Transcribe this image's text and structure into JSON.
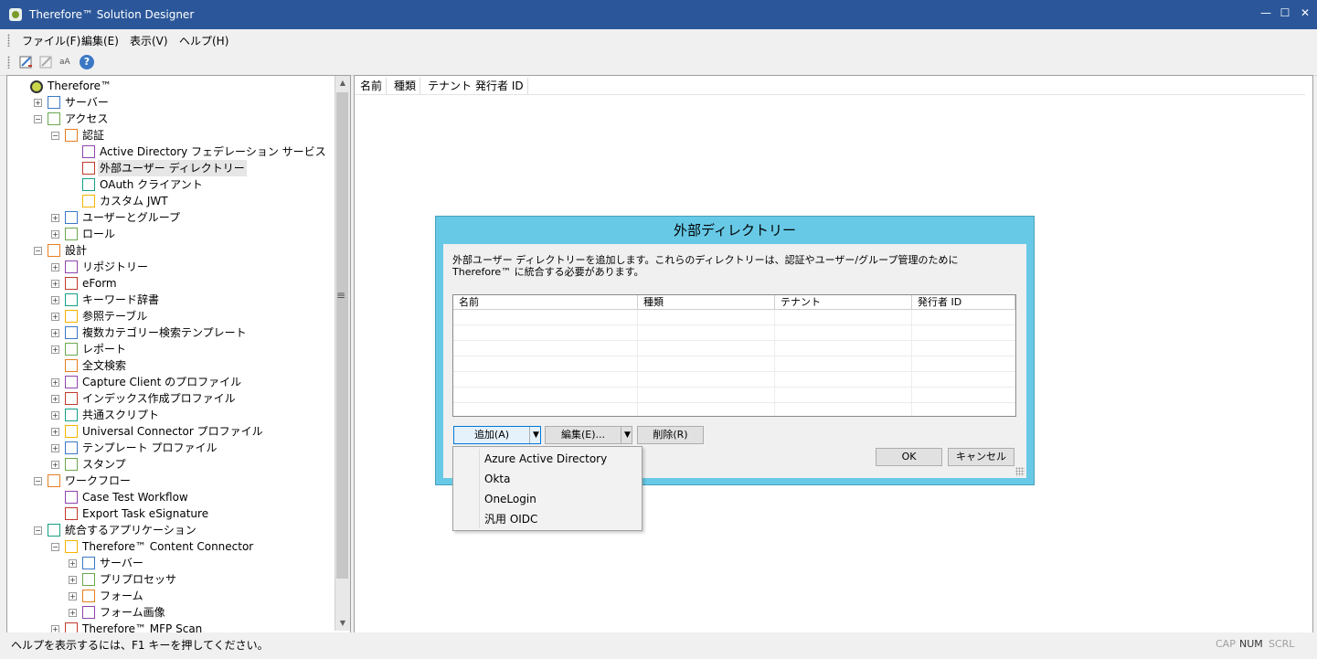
{
  "window": {
    "title": "Therefore™ Solution Designer",
    "controls": {
      "minimize": "—",
      "maximize": "☐",
      "close": "✕"
    }
  },
  "menu": {
    "items": [
      {
        "label": "ファイル(F)"
      },
      {
        "label": "編集(E)"
      },
      {
        "label": "表示(V)"
      },
      {
        "label": "ヘルプ(H)"
      }
    ]
  },
  "toolbar": {
    "icons": [
      "wizard-icon",
      "wizard-disabled-icon",
      "rename-icon",
      "help-icon"
    ],
    "help_glyph": "?",
    "rename_glyph": "aA"
  },
  "tree": {
    "items": [
      {
        "label": "Therefore™",
        "icon": "root-circle-icon"
      },
      {
        "label": "サーバー",
        "icon": "server-icon"
      },
      {
        "label": "アクセス",
        "icon": "access-icon"
      },
      {
        "label": "認証",
        "icon": "folder-card-icon"
      },
      {
        "label": "Active Directory フェデレーション サービス",
        "icon": "id-card-icon"
      },
      {
        "label": "外部ユーザー ディレクトリー",
        "icon": "id-card-icon"
      },
      {
        "label": "OAuth クライアント",
        "icon": "id-card-icon"
      },
      {
        "label": "カスタム JWT",
        "icon": "id-card-icon"
      },
      {
        "label": "ユーザーとグループ",
        "icon": "users-icon"
      },
      {
        "label": "ロール",
        "icon": "role-icon"
      },
      {
        "label": "設計",
        "icon": "design-icon"
      },
      {
        "label": "リポジトリー",
        "icon": "repository-icon"
      },
      {
        "label": "eForm",
        "icon": "eform-icon"
      },
      {
        "label": "キーワード辞書",
        "icon": "dictionary-icon"
      },
      {
        "label": "参照テーブル",
        "icon": "table-icon"
      },
      {
        "label": "複数カテゴリー検索テンプレート",
        "icon": "search-template-icon"
      },
      {
        "label": "レポート",
        "icon": "report-icon"
      },
      {
        "label": "全文検索",
        "icon": "fulltext-icon"
      },
      {
        "label": "Capture Client のプロファイル",
        "icon": "capture-icon"
      },
      {
        "label": "インデックス作成プロファイル",
        "icon": "indexing-icon"
      },
      {
        "label": "共通スクリプト",
        "icon": "script-icon"
      },
      {
        "label": "Universal Connector プロファイル",
        "icon": "connector-icon"
      },
      {
        "label": "テンプレート プロファイル",
        "icon": "template-icon"
      },
      {
        "label": "スタンプ",
        "icon": "stamp-icon"
      },
      {
        "label": "ワークフロー",
        "icon": "workflow-icon"
      },
      {
        "label": "Case Test Workflow",
        "icon": "workflow-icon"
      },
      {
        "label": "Export Task eSignature",
        "icon": "workflow-icon"
      },
      {
        "label": "統合するアプリケーション",
        "icon": "integration-icon"
      },
      {
        "label": "Therefore™ Content Connector",
        "icon": "content-connector-icon"
      },
      {
        "label": "サーバー",
        "icon": "server-icon"
      },
      {
        "label": "プリプロセッサ",
        "icon": "preprocessor-icon"
      },
      {
        "label": "フォーム",
        "icon": "form-icon"
      },
      {
        "label": "フォーム画像",
        "icon": "form-image-icon"
      },
      {
        "label": "Therefore™ MFP Scan",
        "icon": "mfp-icon"
      }
    ]
  },
  "splitter": {
    "grip": "≡"
  },
  "main": {
    "columns": [
      "名前",
      "種類",
      "テナント",
      "発行者 ID"
    ]
  },
  "dialog": {
    "title": "外部ディレクトリー",
    "description": "外部ユーザー ディレクトリーを追加します。これらのディレクトリーは、認証やユーザー/グループ管理のために Therefore™ に統合する必要があります。",
    "columns": [
      "名前",
      "種類",
      "テナント",
      "発行者 ID"
    ],
    "add_label": "追加(A)",
    "edit_label": "編集(E)...",
    "delete_label": "削除(R)",
    "ok_label": "OK",
    "cancel_label": "キャンセル",
    "dropdown_arrow": "▼"
  },
  "add_menu": {
    "items": [
      "Azure Active Directory",
      "Okta",
      "OneLogin",
      "汎用 OIDC"
    ]
  },
  "status": {
    "text": "ヘルプを表示するには、F1 キーを押してください。",
    "cap": "CAP",
    "num": "NUM",
    "scrl": "SCRL"
  },
  "scrollbar": {
    "up": "▲",
    "down": "▼"
  }
}
